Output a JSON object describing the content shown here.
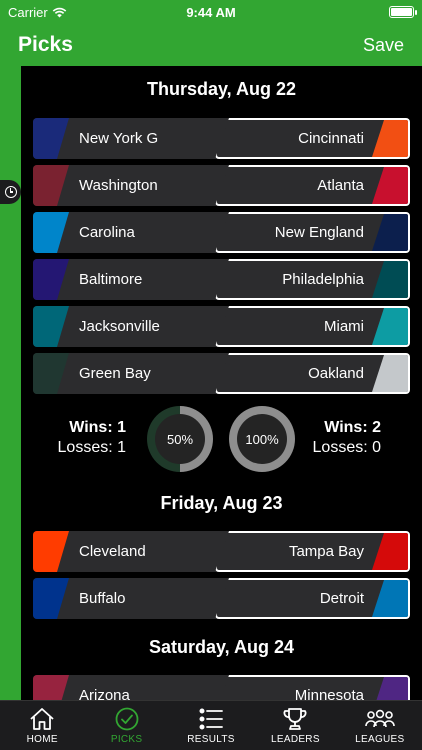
{
  "status": {
    "carrier": "Carrier",
    "time": "9:44 AM"
  },
  "nav": {
    "title": "Picks",
    "save_label": "Save"
  },
  "days": [
    {
      "date": "Thursday, Aug 22",
      "games": [
        {
          "home": "New York G",
          "away": "Cincinnati",
          "home_color": "#1a2a7a",
          "away_color": "#f24f13"
        },
        {
          "home": "Washington",
          "away": "Atlanta",
          "home_color": "#7a2230",
          "away_color": "#c8102e"
        },
        {
          "home": "Carolina",
          "away": "New England",
          "home_color": "#0085ca",
          "away_color": "#0c1f4d"
        },
        {
          "home": "Baltimore",
          "away": "Philadelphia",
          "home_color": "#241773",
          "away_color": "#004c54"
        },
        {
          "home": "Jacksonville",
          "away": "Miami",
          "home_color": "#006778",
          "away_color": "#0d9ca3"
        },
        {
          "home": "Green Bay",
          "away": "Oakland",
          "home_color": "#203731",
          "away_color": "#c4c8cb"
        }
      ]
    },
    {
      "date": "Friday, Aug 23",
      "games": [
        {
          "home": "Cleveland",
          "away": "Tampa Bay",
          "home_color": "#ff3c00",
          "away_color": "#d50a0a"
        },
        {
          "home": "Buffalo",
          "away": "Detroit",
          "home_color": "#00338d",
          "away_color": "#0076b6"
        }
      ]
    },
    {
      "date": "Saturday, Aug 24",
      "games": [
        {
          "home": "Arizona",
          "away": "Minnesota",
          "home_color": "#97233f",
          "away_color": "#4f2683"
        }
      ]
    }
  ],
  "stats": {
    "left": {
      "wins": "Wins: 1",
      "losses": "Losses: 1",
      "percent_label": "50%",
      "percent": 50
    },
    "right": {
      "wins": "Wins: 2",
      "losses": "Losses: 0",
      "percent_label": "100%",
      "percent": 100
    }
  },
  "tabs": [
    {
      "label": "HOME",
      "icon": "home-icon"
    },
    {
      "label": "PICKS",
      "icon": "check-circle-icon",
      "active": true
    },
    {
      "label": "RESULTS",
      "icon": "list-icon"
    },
    {
      "label": "LEADERS",
      "icon": "trophy-icon"
    },
    {
      "label": "LEAGUES",
      "icon": "group-icon"
    }
  ],
  "colors": {
    "accent": "#32a632",
    "background": "#000000",
    "card": "#2c2c2e"
  }
}
